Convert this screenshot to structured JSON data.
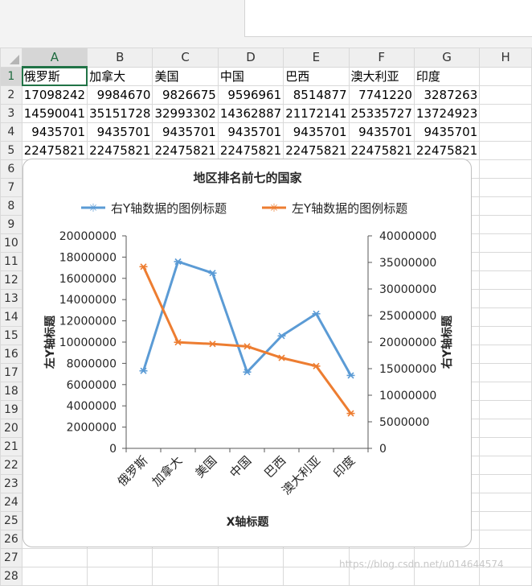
{
  "columns": [
    "A",
    "B",
    "C",
    "D",
    "E",
    "F",
    "G",
    "H"
  ],
  "rows": [
    [
      "俄罗斯",
      "加拿大",
      "美国",
      "中国",
      "巴西",
      "澳大利亚",
      "印度"
    ],
    [
      17098242,
      9984670,
      9826675,
      9596961,
      8514877,
      7741220,
      3287263
    ],
    [
      14590041,
      35151728,
      32993302,
      14362887,
      21172141,
      25335727,
      13724923
    ],
    [
      9435701,
      9435701,
      9435701,
      9435701,
      9435701,
      9435701,
      9435701
    ],
    [
      22475821,
      22475821,
      22475821,
      22475821,
      22475821,
      22475821,
      22475821
    ]
  ],
  "row_numbers": [
    "1",
    "2",
    "3",
    "4",
    "5",
    "6",
    "7",
    "8",
    "9",
    "10",
    "11",
    "12",
    "13",
    "14",
    "15",
    "16",
    "17",
    "18",
    "19",
    "20",
    "21",
    "22",
    "23",
    "24",
    "25",
    "26",
    "27",
    "28"
  ],
  "watermark": "https://blog.csdn.net/u014644574",
  "colors": {
    "accent": "#217346",
    "series_right": "#5b9bd5",
    "series_left": "#ed7d31"
  },
  "chart_data": {
    "type": "line",
    "title": "地区排名前七的国家",
    "xlabel": "X轴标题",
    "ylabel": "左Y轴标题",
    "y2label": "右Y轴标题",
    "categories": [
      "俄罗斯",
      "加拿大",
      "美国",
      "中国",
      "巴西",
      "澳大利亚",
      "印度"
    ],
    "ylim": [
      0,
      20000000
    ],
    "y2lim": [
      0,
      40000000
    ],
    "y_ticks": [
      "0",
      "2000000",
      "4000000",
      "6000000",
      "8000000",
      "10000000",
      "12000000",
      "14000000",
      "16000000",
      "18000000",
      "20000000"
    ],
    "y2_ticks": [
      "0",
      "5000000",
      "10000000",
      "15000000",
      "20000000",
      "25000000",
      "30000000",
      "35000000",
      "40000000"
    ],
    "legend_position": "top",
    "grid": false,
    "series": [
      {
        "name": "右Y轴数据的图例标题",
        "axis": "right",
        "color": "#5b9bd5",
        "values": [
          14590041,
          35151728,
          32993302,
          14362887,
          21172141,
          25335727,
          13724923
        ]
      },
      {
        "name": "左Y轴数据的图例标题",
        "axis": "left",
        "color": "#ed7d31",
        "values": [
          17098242,
          9984670,
          9826675,
          9596961,
          8514877,
          7741220,
          3287263
        ]
      }
    ]
  }
}
